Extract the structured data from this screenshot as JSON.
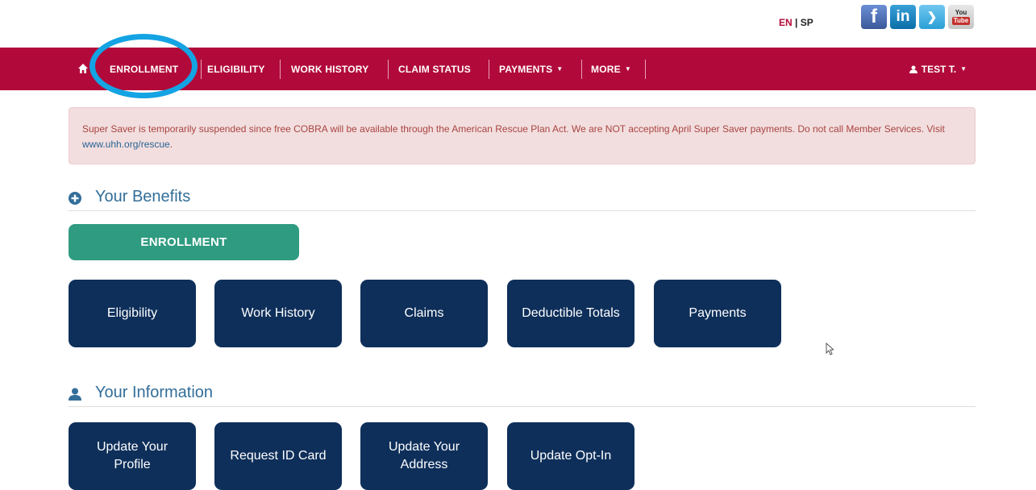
{
  "language": {
    "en": "EN",
    "separator": "|",
    "sp": "SP"
  },
  "social": [
    {
      "name": "facebook-icon",
      "glyph": "f"
    },
    {
      "name": "linkedin-icon",
      "glyph": "in"
    },
    {
      "name": "twitter-icon",
      "glyph": "❯"
    },
    {
      "name": "youtube-icon",
      "top": "You",
      "bottom": "Tube"
    }
  ],
  "nav": {
    "home_icon": "home-icon",
    "items": [
      {
        "label": "ENROLLMENT"
      },
      {
        "label": "ELIGIBILITY"
      },
      {
        "label": "WORK HISTORY"
      },
      {
        "label": "CLAIM STATUS"
      },
      {
        "label": "PAYMENTS"
      },
      {
        "label": "MORE"
      }
    ],
    "user": "TEST T."
  },
  "alert": {
    "text": "Super Saver is temporarily suspended since free COBRA will be available through the American Rescue Plan Act. We are NOT accepting April Super Saver payments. Do not call Member Services. Visit ",
    "link": "www.uhh.org/rescue",
    "end": "."
  },
  "benefits": {
    "title": "Your Benefits",
    "enrollment_label": "ENROLLMENT",
    "tiles": [
      "Eligibility",
      "Work History",
      "Claims",
      "Deductible Totals",
      "Payments"
    ]
  },
  "information": {
    "title": "Your Information",
    "tiles": [
      "Update Your Profile",
      "Request ID Card",
      "Update Your Address",
      "Update Opt-In"
    ]
  },
  "colors": {
    "navbar": "#b10a3a",
    "highlight_ring": "#14a3e3",
    "enrollment_button": "#2f9b80",
    "tile": "#0e2f5a",
    "section_title": "#336e99"
  }
}
